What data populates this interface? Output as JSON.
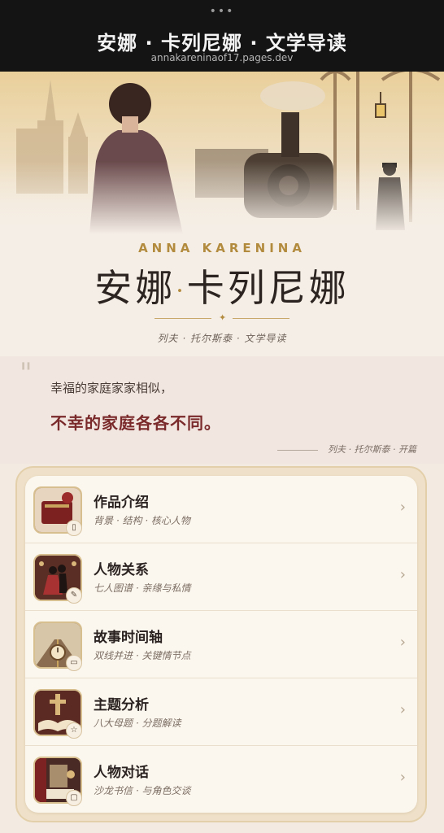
{
  "browser": {
    "menu_dots": "•••",
    "title": "安娜 · 卡列尼娜 · 文学导读",
    "url": "annakareninaof17.pages.dev"
  },
  "header": {
    "english_title": "ANNA KARENINA",
    "title_part1": "安娜",
    "title_dot": "·",
    "title_part2": "卡列尼娜",
    "divider_star": "✦",
    "subtitle": "列夫 · 托尔斯泰 · 文学导读"
  },
  "quote": {
    "mark": "\"",
    "line1": "幸福的家庭家家相似，",
    "line2": "不幸的家庭各各不同。",
    "source": "列夫 · 托尔斯泰 · 开篇"
  },
  "menu": {
    "items": [
      {
        "title": "作品介绍",
        "subtitle": "背景 · 结构 · 核心人物",
        "icon": "book-icon",
        "badge": "▯"
      },
      {
        "title": "人物关系",
        "subtitle": "七人图谱 · 亲缘与私情",
        "icon": "dancers-icon",
        "badge": "✎"
      },
      {
        "title": "故事时间轴",
        "subtitle": "双线并进 · 关键情节点",
        "icon": "railway-clock-icon",
        "badge": "▭"
      },
      {
        "title": "主题分析",
        "subtitle": "八大母题 · 分题解读",
        "icon": "cross-book-icon",
        "badge": "☆"
      },
      {
        "title": "人物对话",
        "subtitle": "沙龙书信 · 与角色交谈",
        "icon": "salon-letter-icon",
        "badge": "▢"
      }
    ],
    "chevron": "›"
  },
  "colors": {
    "gold": "#b38b3e",
    "burgundy": "#7a2a2a",
    "topbar": "#141414",
    "background": "#f3ebe1"
  }
}
